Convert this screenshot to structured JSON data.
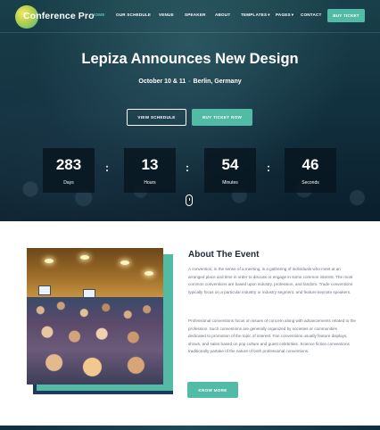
{
  "nav": {
    "logo_text": "Conference Pro",
    "links": [
      {
        "label": "HOME",
        "active": true
      },
      {
        "label": "OUR SCHEDULE",
        "active": false
      },
      {
        "label": "VENUE",
        "active": false
      },
      {
        "label": "SPEAKER",
        "active": false
      },
      {
        "label": "ABOUT",
        "active": false
      },
      {
        "label": "TEMPLATES",
        "active": false,
        "dropdown": true
      },
      {
        "label": "PAGES",
        "active": false,
        "dropdown": true
      },
      {
        "label": "CONTACT",
        "active": false
      }
    ],
    "cta_label": "BUY TICKET"
  },
  "hero": {
    "title": "Lepiza Announces New Design",
    "date": "October 10 & 11",
    "separator": "-",
    "location": "Berlin, Germany",
    "btn_schedule": "VIEW SCHEDULE",
    "btn_buy": "BUY TICKET NOW",
    "countdown": [
      {
        "value": "283",
        "label": "Days"
      },
      {
        "value": "13",
        "label": "Hours"
      },
      {
        "value": "54",
        "label": "Minutes"
      },
      {
        "value": "46",
        "label": "Seconds"
      }
    ],
    "countdown_separator": ":"
  },
  "about": {
    "title": "About The Event",
    "paragraph1": "A convention, in the sense of a meeting, is a gathering of individuals who meet at an arranged place and time in order to discuss or engage in some common interest. The most common conventions are based upon industry, profession, and fandom. Trade conventions typically focus on a particular industry or industry segment, and feature keynote speakers.",
    "paragraph2": "Professional conventions focus on issues of concern along with advancements related to the profession. Such conventions are generally organized by societies or communities dedicated to promotion of the topic of interest. Fan conventions usually feature displays, shows, and sales based on pop culture and guest celebrities. Science fiction conventions traditionally partake of the nature of both professional conventions.",
    "btn_more": "KNOW MORE"
  },
  "colors": {
    "accent": "#52bba5",
    "hero_dark": "#12313f",
    "heading": "#1e2a36",
    "frame_navy": "#1f3a5c"
  },
  "icons": {
    "logo": "logo-circle-icon",
    "scroll": "mouse-scroll-icon",
    "dropdown": "chevron-down-icon"
  }
}
